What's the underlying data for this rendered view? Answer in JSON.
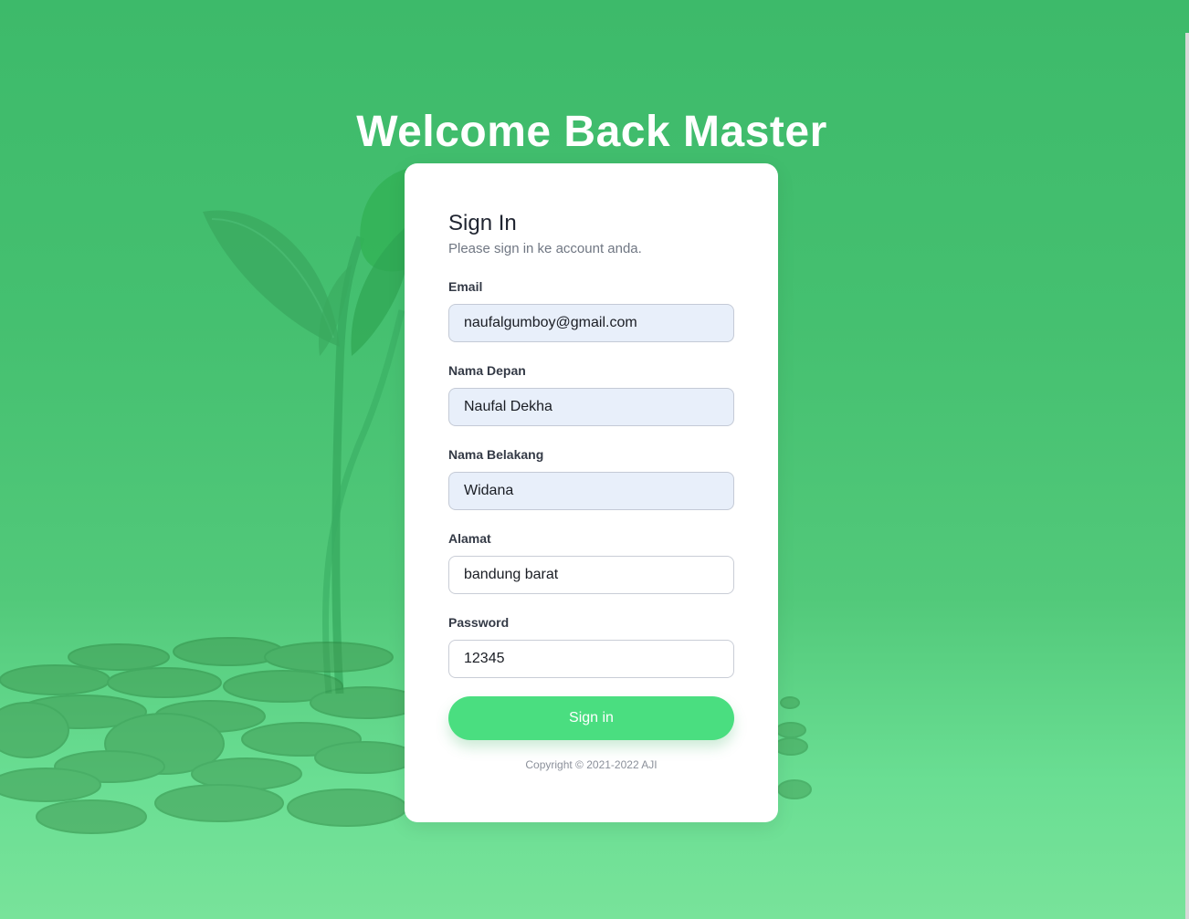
{
  "page": {
    "heading": "Welcome Back Master"
  },
  "card": {
    "title": "Sign In",
    "subtitle": "Please sign in ke account anda."
  },
  "form": {
    "email": {
      "label": "Email",
      "value": "naufalgumboy@gmail.com"
    },
    "first_name": {
      "label": "Nama Depan",
      "value": "Naufal Dekha"
    },
    "last_name": {
      "label": "Nama Belakang",
      "value": "Widana"
    },
    "address": {
      "label": "Alamat",
      "value": "bandung barat"
    },
    "password": {
      "label": "Password",
      "value": "12345"
    },
    "submit_label": "Sign in"
  },
  "footer": {
    "copyright": "Copyright © 2021-2022 AJI"
  },
  "colors": {
    "background": "#45c070",
    "button": "#4ade80",
    "autofill_bg": "#e8effa"
  }
}
